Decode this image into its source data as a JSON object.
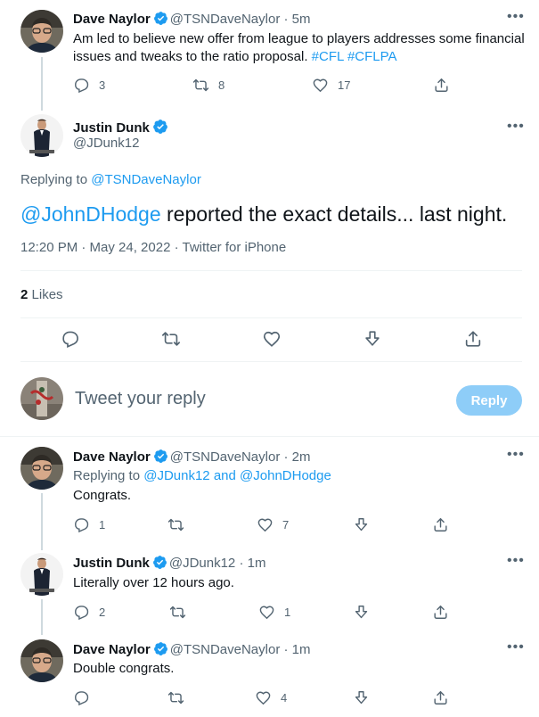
{
  "tweet1": {
    "name": "Dave Naylor",
    "handle": "@TSNDaveNaylor",
    "time": "· 5m",
    "text_main": "Am led to believe new offer from league to players addresses some financial issues and tweaks to the ratio proposal. ",
    "hashtag1": "#CFL",
    "hashtag2": "#CFLPA",
    "replies": "3",
    "retweets": "8",
    "likes": "17"
  },
  "main_tweet": {
    "name": "Justin Dunk",
    "handle": "@JDunk12",
    "replying_label": "Replying to ",
    "replying_to": "@TSNDaveNaylor",
    "mention": "@JohnDHodge",
    "text": " reported the exact details... last night.",
    "timestamp": "12:20 PM · May 24, 2022 · Twitter for iPhone",
    "likes_count": "2",
    "likes_label": "Likes"
  },
  "reply_box": {
    "placeholder": "Tweet your reply",
    "button": "Reply"
  },
  "reply1": {
    "name": "Dave Naylor",
    "handle": "@TSNDaveNaylor",
    "time": "· 2m",
    "replying_label": "Replying to ",
    "replying_to_1": "@JDunk12",
    "and": " and ",
    "replying_to_2": "@JohnDHodge",
    "text": "Congrats.",
    "replies": "1",
    "retweets": "",
    "likes": "7"
  },
  "reply2": {
    "name": "Justin Dunk",
    "handle": "@JDunk12",
    "time": "· 1m",
    "text": "Literally over 12 hours ago.",
    "replies": "2",
    "retweets": "",
    "likes": "1"
  },
  "reply3": {
    "name": "Dave Naylor",
    "handle": "@TSNDaveNaylor",
    "time": "· 1m",
    "text": "Double congrats.",
    "replies": "",
    "retweets": "",
    "likes": "4"
  },
  "more_glyph": "•••",
  "colors": {
    "accent": "#1d9bf0",
    "muted": "#536471",
    "reply_button_disabled": "#8ecdf8"
  }
}
